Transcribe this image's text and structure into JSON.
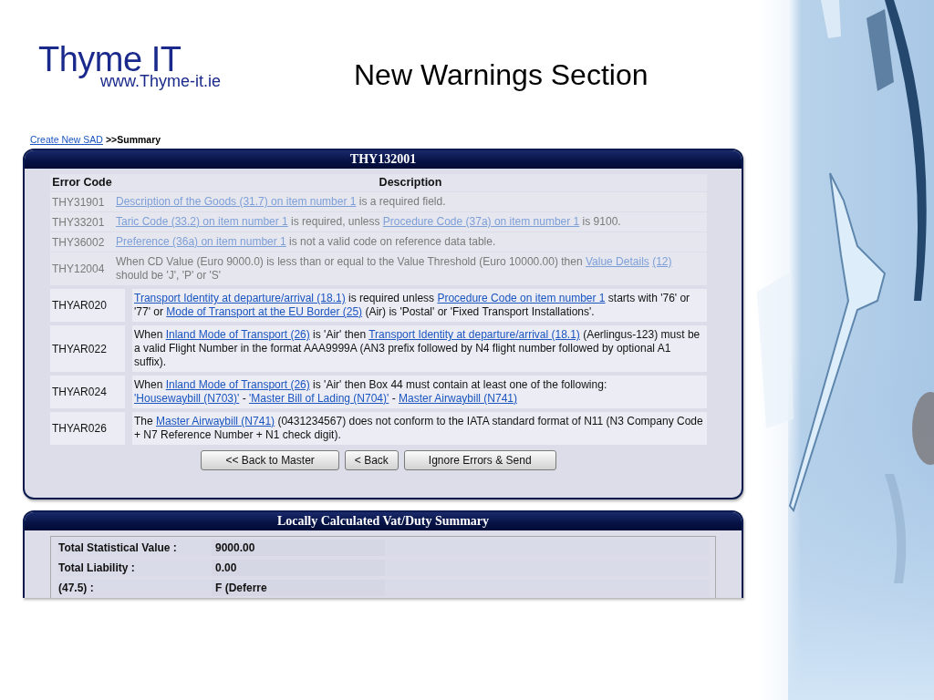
{
  "logo": {
    "name": "Thyme IT",
    "url": "www.Thyme-it.ie"
  },
  "title": "New Warnings Section",
  "breadcrumb": {
    "link": "Create New SAD",
    "current": ">>Summary"
  },
  "errors_panel": {
    "title": "THY132001",
    "columns": [
      "Error Code",
      "Description"
    ],
    "rows": [
      {
        "code": "THY31901",
        "faded": true,
        "description": [
          {
            "text": "Description of the Goods (31.7) on item number 1",
            "link": true
          },
          {
            "text": " is a required field.",
            "link": false
          }
        ]
      },
      {
        "code": "THY33201",
        "faded": true,
        "description": [
          {
            "text": "Taric Code (33.2) on item number 1",
            "link": true
          },
          {
            "text": " is required, unless ",
            "link": false
          },
          {
            "text": "Procedure Code (37a) on item number 1",
            "link": true
          },
          {
            "text": " is 9100.",
            "link": false
          }
        ]
      },
      {
        "code": "THY36002",
        "faded": true,
        "description": [
          {
            "text": "Preference (36a) on item number 1",
            "link": true
          },
          {
            "text": " is not a valid code on reference data table.",
            "link": false
          }
        ]
      },
      {
        "code": "THY12004",
        "faded": true,
        "description": [
          {
            "text": "When CD Value (Euro 9000.0) is less than or equal to the Value Threshold (Euro 10000.00) then ",
            "link": false
          },
          {
            "text": "Value Details",
            "link": true
          },
          {
            "text": "(12)",
            "link": true
          },
          {
            "text": " should be 'J', 'P' or 'S'",
            "link": false
          }
        ]
      },
      {
        "code": "THYAR020",
        "faded": false,
        "description": [
          {
            "text": "Transport Identity at departure/arrival (18.1)",
            "link": true
          },
          {
            "text": " is required unless ",
            "link": false
          },
          {
            "text": "Procedure Code on item number 1",
            "link": true
          },
          {
            "text": " starts with '76' or '77' or ",
            "link": false
          },
          {
            "text": "Mode of Transport at the EU Border (25)",
            "link": true
          },
          {
            "text": " (Air) is 'Postal' or 'Fixed Transport Installations'.",
            "link": false
          }
        ]
      },
      {
        "code": "THYAR022",
        "faded": false,
        "description": [
          {
            "text": "When ",
            "link": false
          },
          {
            "text": "Inland Mode of Transport (26)",
            "link": true
          },
          {
            "text": " is 'Air' then ",
            "link": false
          },
          {
            "text": "Transport Identity at departure/arrival (18.1)",
            "link": true
          },
          {
            "text": " (Aerlingus-123) must be a valid Flight Number in the format AAA9999A (AN3 prefix followed by N4 flight number followed by optional A1 suffix).",
            "link": false
          }
        ]
      },
      {
        "code": "THYAR024",
        "faded": false,
        "description": [
          {
            "text": "When ",
            "link": false
          },
          {
            "text": "Inland Mode of Transport (26)",
            "link": true
          },
          {
            "text": " is 'Air' then Box 44 must contain at least one of the following: ",
            "link": false
          },
          {
            "text": "'Housewaybill (N703)'",
            "link": true
          },
          {
            "text": " - ",
            "link": false
          },
          {
            "text": "'Master Bill of Lading (N704)'",
            "link": true
          },
          {
            "text": " - ",
            "link": false
          },
          {
            "text": "Master Airwaybill (N741)",
            "link": true
          }
        ]
      },
      {
        "code": "THYAR026",
        "faded": false,
        "description": [
          {
            "text": "The ",
            "link": false
          },
          {
            "text": "Master Airwaybill (N741)",
            "link": true
          },
          {
            "text": " (0431234567) does not conform to the IATA standard format of N11 (N3 Company Code + N7 Reference Number + N1 check digit).",
            "link": false
          }
        ]
      }
    ],
    "buttons": [
      "<< Back to Master",
      "< Back",
      "Ignore Errors & Send"
    ]
  },
  "summary_panel": {
    "title": "Locally Calculated Vat/Duty Summary",
    "rows": [
      {
        "label": "Total Statistical Value :",
        "value": "9000.00"
      },
      {
        "label": "Total Liability :",
        "value": "0.00"
      },
      {
        "label": "(47.5) :",
        "value": "F (Deferre"
      }
    ]
  }
}
